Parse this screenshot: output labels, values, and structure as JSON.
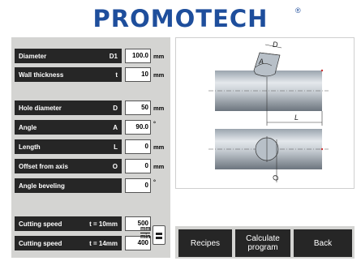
{
  "header": {
    "logo": "PROMOTECH",
    "logo_reg": "®"
  },
  "params": [
    {
      "label": "Diameter",
      "symbol": "D1",
      "value": "100.0",
      "unit": "mm"
    },
    {
      "label": "Wall thickness",
      "symbol": "t",
      "value": "10",
      "unit": "mm"
    },
    {
      "label": "Hole diameter",
      "symbol": "D",
      "value": "50",
      "unit": "mm"
    },
    {
      "label": "Angle",
      "symbol": "A",
      "value": "90.0",
      "unit": "°"
    },
    {
      "label": "Length",
      "symbol": "L",
      "value": "0",
      "unit": "mm"
    },
    {
      "label": "Offset from axis",
      "symbol": "O",
      "value": "0",
      "unit": "mm"
    },
    {
      "label": "Angle beveling",
      "symbol": "",
      "value": "0",
      "unit": "°"
    }
  ],
  "speed": [
    {
      "label": "Cutting speed",
      "condition": "t = 10mm",
      "value": "500"
    },
    {
      "label": "Cutting speed",
      "condition": "t = 14mm",
      "value": "400"
    }
  ],
  "speed_unit": {
    "top": "mm",
    "bottom": "min"
  },
  "drawing": {
    "label_d": "D",
    "label_a": "A",
    "label_l": "L",
    "label_o": "O"
  },
  "buttons": {
    "recipes": "Recipes",
    "calculate_1": "Calculate",
    "calculate_2": "program",
    "back": "Back"
  },
  "colors": {
    "brand": "#1e4e9c",
    "label_bg": "#262626",
    "panel_bg": "#d4d4d2"
  }
}
